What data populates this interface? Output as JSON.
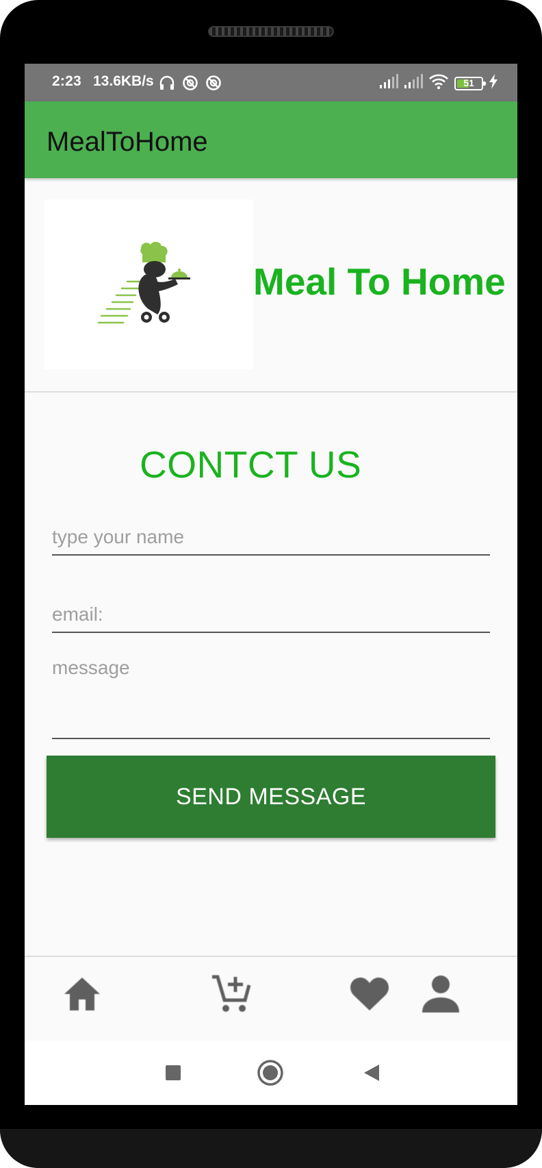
{
  "status_bar": {
    "time": "2:23",
    "network_speed": "13.6KB/s",
    "battery_level": "51",
    "battery_fraction": 0.51,
    "icons": [
      "headphones-icon",
      "vpn-icon",
      "vpn-icon",
      "signal-icon",
      "signal-icon",
      "wifi-icon",
      "battery-icon",
      "charging-icon"
    ]
  },
  "app_bar": {
    "title": "MealToHome"
  },
  "header": {
    "logo_icon": "chef-delivery-logo",
    "brand_name": "Meal To Home",
    "brand_color": "#1ab31f"
  },
  "contact": {
    "heading": "CONTCT US",
    "name_placeholder": "type your name",
    "email_placeholder": "email:",
    "message_placeholder": "message",
    "send_label": "SEND MESSAGE"
  },
  "bottom_nav": {
    "items": [
      {
        "icon": "home-icon"
      },
      {
        "icon": "add-to-cart-icon"
      },
      {
        "icon": "favorite-icon"
      },
      {
        "icon": "profile-icon"
      }
    ]
  },
  "system_nav": {
    "items": [
      {
        "icon": "recents-icon"
      },
      {
        "icon": "home-circle-icon"
      },
      {
        "icon": "back-icon"
      }
    ]
  },
  "colors": {
    "app_bar": "#4caf50",
    "button": "#2e7d32",
    "accent_text": "#1ab31f",
    "status_bar": "#757575"
  }
}
